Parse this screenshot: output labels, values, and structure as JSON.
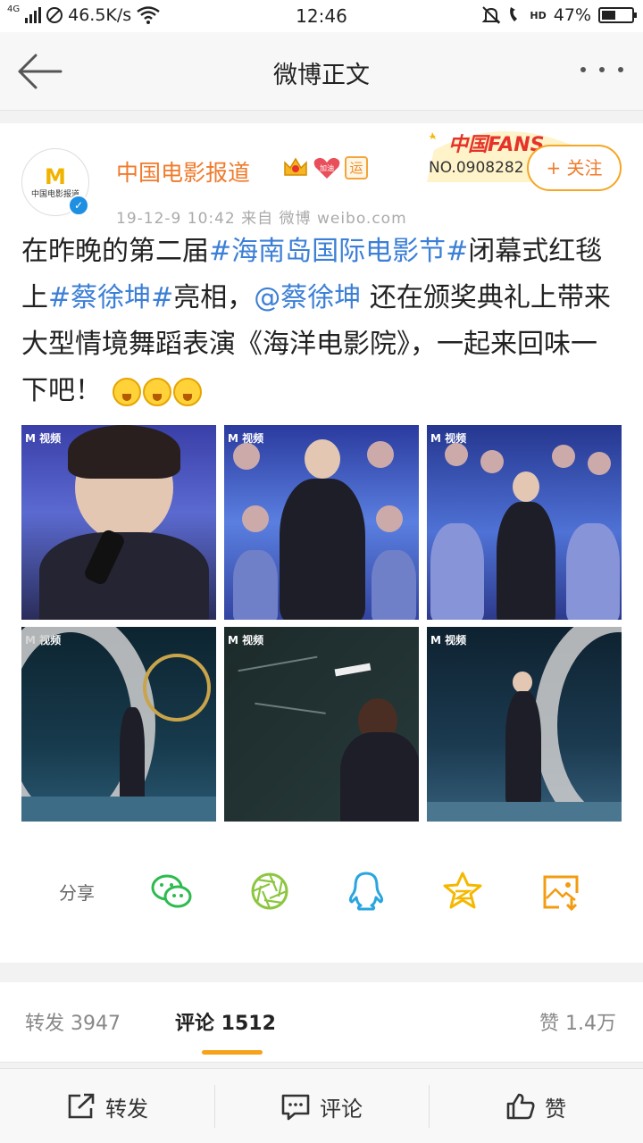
{
  "status_bar": {
    "network": "4G",
    "speed": "46.5K/s",
    "time": "12:46",
    "hd": "HD",
    "battery": "47%",
    "battery_level": 0.47
  },
  "nav": {
    "title": "微博正文"
  },
  "post": {
    "author": "中国电影报道",
    "avatar_logo": "M",
    "avatar_text": "中国电影报道",
    "badge_jiayou": "加油",
    "badge_yun": "运",
    "meta": "19-12-9 10:42  来自 微博 weibo.com",
    "fans_title": "中国FANS",
    "fans_no": "NO.0908282",
    "follow_label": "+ 关注",
    "text_parts": {
      "p1": "在昨晚的第二届",
      "tag1": "#海南岛国际电影节#",
      "p2": "闭幕式红毯上",
      "tag2": "#蔡徐坤#",
      "p3": "亮相，",
      "mention": "@蔡徐坤",
      "p4": " 还在颁奖典礼上带来大型情境舞蹈表演《海洋电影院》，一起来回味一下吧！"
    },
    "image_watermark": "M 视频",
    "photos": [
      {
        "scene": "closeup-mic"
      },
      {
        "scene": "stage-crowd"
      },
      {
        "scene": "stage-crowd-wide"
      },
      {
        "scene": "film-reel-walk"
      },
      {
        "scene": "signing-wall"
      },
      {
        "scene": "film-reel-walk-2"
      }
    ]
  },
  "share": {
    "label": "分享",
    "icons": [
      "wechat-icon",
      "moments-icon",
      "qq-icon",
      "qzone-icon",
      "save-image-icon"
    ],
    "colors": {
      "wechat": "#2dbb4f",
      "moments": "#8cc63f",
      "qq": "#2aa5e0",
      "qzone": "#f5b800",
      "save": "#f39c12"
    }
  },
  "tabs": {
    "repost": "转发 3947",
    "comments": "评论 1512",
    "likes": "赞 1.4万"
  },
  "actions": {
    "repost": "转发",
    "comment": "评论",
    "like": "赞"
  },
  "colors": {
    "accent": "#f7a21b",
    "link": "#3c7fd6",
    "author": "#f07a2b"
  }
}
